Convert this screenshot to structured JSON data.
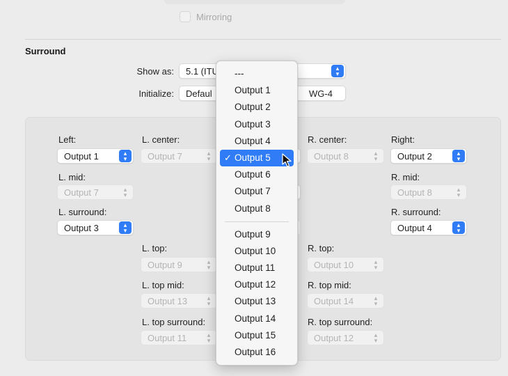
{
  "mirroring": {
    "label": "Mirroring",
    "checked": false
  },
  "surround": {
    "title": "Surround",
    "show_as_label": "Show as:",
    "show_as_value": "5.1 (ITU",
    "initialize_label": "Initialize:",
    "initialize_value": "Defaul",
    "initialize_right_value": "WG-4"
  },
  "speakers": {
    "left": {
      "label": "Left:",
      "value": "Output 1"
    },
    "l_center": {
      "label": "L. center:",
      "value": "Output 7"
    },
    "r_center": {
      "label": "R. center:",
      "value": "Output 8"
    },
    "right": {
      "label": "Right:",
      "value": "Output 2"
    },
    "l_mid": {
      "label": "L. mid:",
      "value": "Output 7"
    },
    "r_mid": {
      "label": "R. mid:",
      "value": "Output 8"
    },
    "l_surround": {
      "label": "L. surround:",
      "value": "Output 3"
    },
    "r_surround": {
      "label": "R. surround:",
      "value": "Output 4"
    },
    "l_top": {
      "label": "L. top:",
      "value": "Output 9"
    },
    "r_top": {
      "label": "R. top:",
      "value": "Output 10"
    },
    "l_top_mid": {
      "label": "L. top mid:",
      "value": "Output 13"
    },
    "r_top_mid": {
      "label": "R. top mid:",
      "value": "Output 14"
    },
    "l_top_surround": {
      "label": "L. top surround:",
      "value": "Output 11"
    },
    "r_top_surround": {
      "label": "R. top surround:",
      "value": "Output 12"
    }
  },
  "menu": {
    "selected": "Output 5",
    "check_glyph": "✓",
    "items": [
      "---",
      "Output 1",
      "Output 2",
      "Output 3",
      "Output 4",
      "Output 5",
      "Output 6",
      "Output 7",
      "Output 8",
      "Output 9",
      "Output 10",
      "Output 11",
      "Output 12",
      "Output 13",
      "Output 14",
      "Output 15",
      "Output 16"
    ]
  },
  "colors": {
    "accent": "#2f7cf6"
  }
}
